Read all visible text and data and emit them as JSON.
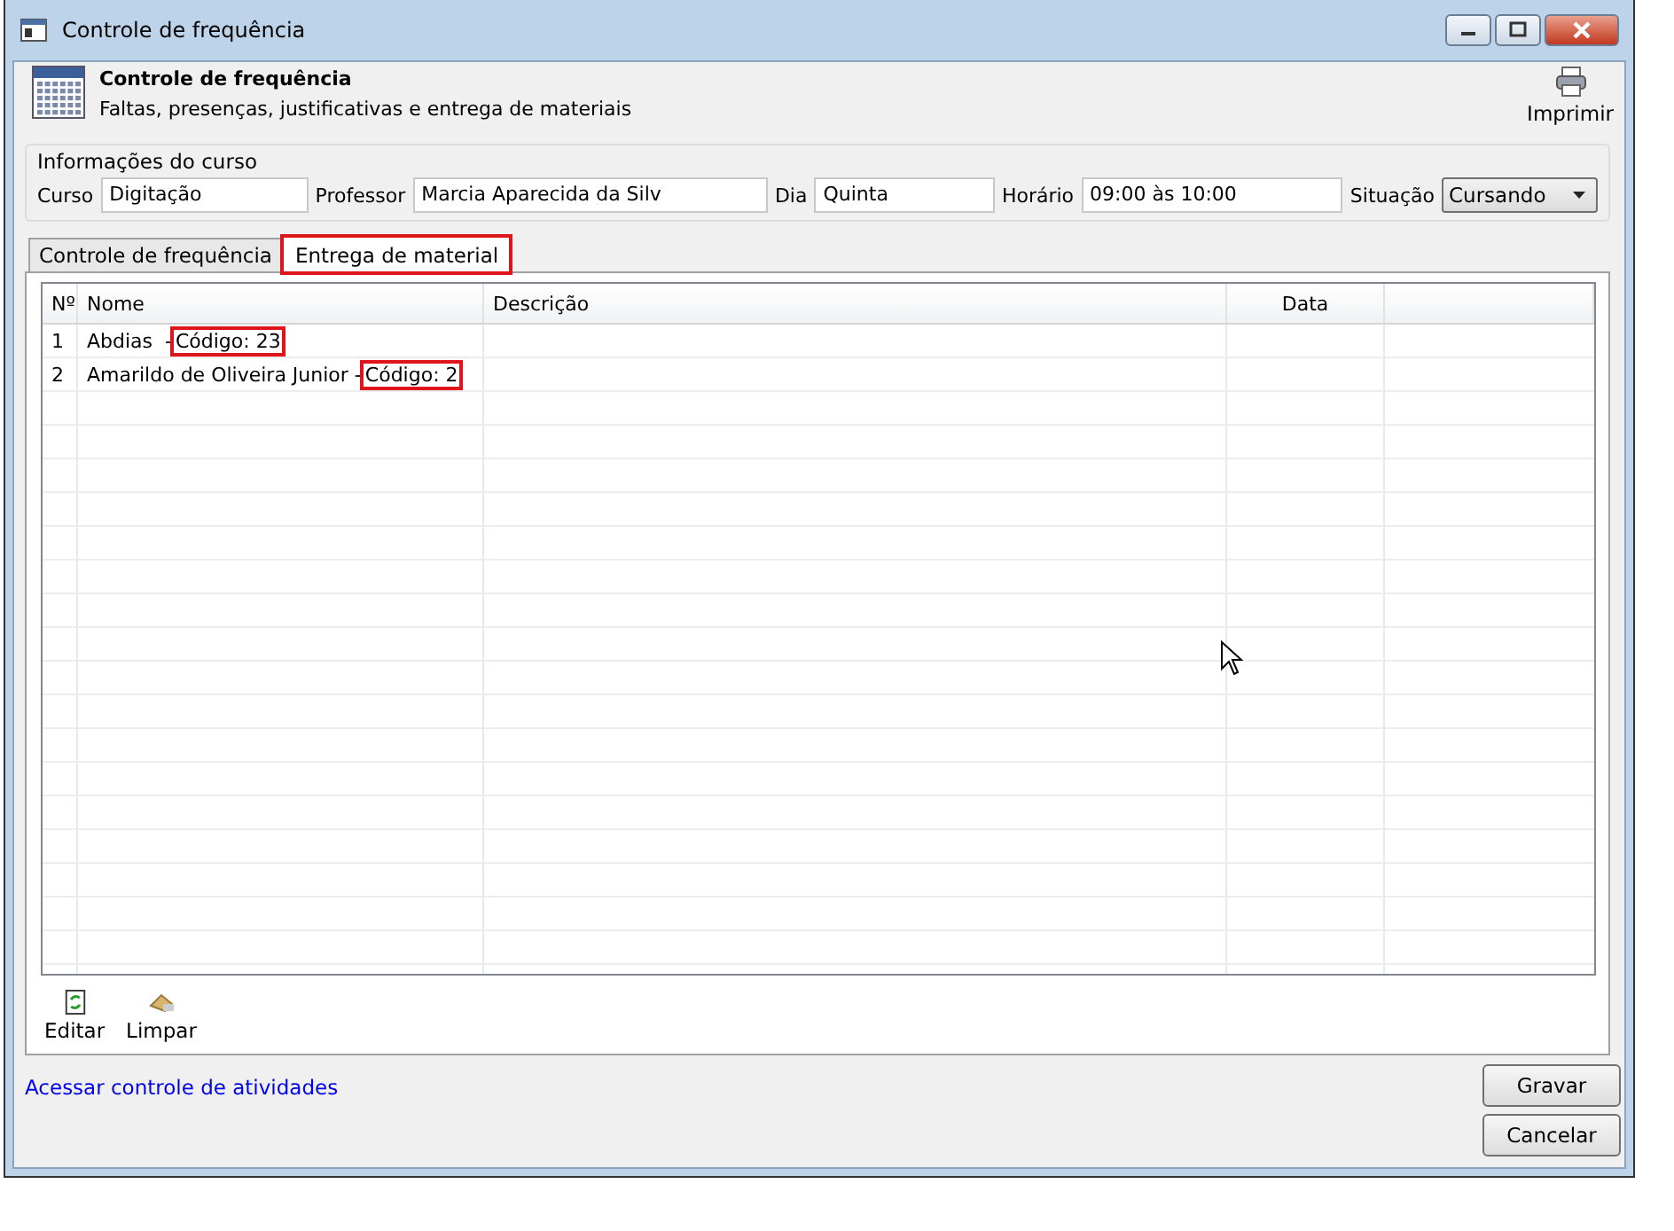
{
  "window": {
    "title": "Controle de frequência"
  },
  "header": {
    "title": "Controle de frequência",
    "subtitle": "Faltas, presenças, justificativas e entrega de materiais",
    "print_button": "Imprimir"
  },
  "course_info": {
    "label": "Informações do curso",
    "fields": [
      {
        "label": "Curso",
        "value": "Digitação",
        "kind": "text"
      },
      {
        "label": "Professor",
        "value": "Marcia Aparecida da Silv",
        "kind": "text"
      },
      {
        "label": "Dia",
        "value": "Quinta",
        "kind": "text"
      },
      {
        "label": "Horário",
        "value": "09:00 às 10:00",
        "kind": "text"
      },
      {
        "label": "Situação",
        "value": "Cursando",
        "kind": "select"
      }
    ]
  },
  "tabs": [
    {
      "label": "Controle de frequência",
      "selected": false,
      "highlighted": false
    },
    {
      "label": "Entrega de material",
      "selected": true,
      "highlighted": true
    }
  ],
  "table": {
    "columns": [
      "Nº",
      "Nome",
      "Descrição",
      "Data"
    ],
    "rows": [
      {
        "number": "1",
        "name": "Abdias  -",
        "code": "Código: 23",
        "code_highlighted": true
      },
      {
        "number": "2",
        "name": "Amarildo de Oliveira Junior -",
        "code": "Código: 2",
        "code_highlighted": true
      }
    ]
  },
  "toolbar": [
    {
      "label": "Editar",
      "kind": "edit"
    },
    {
      "label": "Limpar",
      "kind": "clear"
    }
  ],
  "footer": {
    "link": "Acessar controle de atividades",
    "buttons": [
      "Gravar",
      "Cancelar"
    ]
  }
}
